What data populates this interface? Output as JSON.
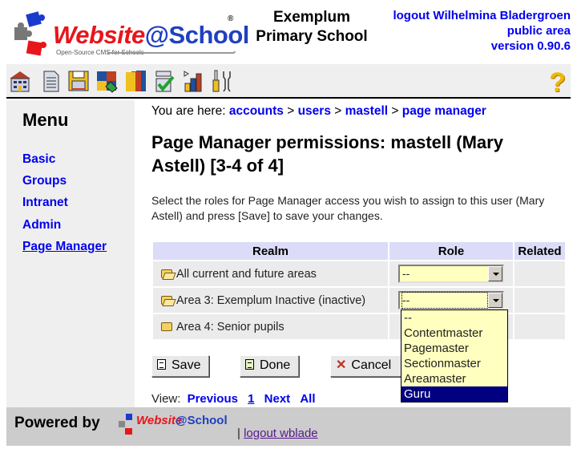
{
  "header": {
    "logo_text_part1": "Website",
    "logo_text_part2": "@School",
    "logo_tagline": "Open-Source CMS for Schools",
    "logo_reg": "®",
    "school_name_line1": "Exemplum",
    "school_name_line2": "Primary School",
    "logout_link": "logout Wilhelmina Bladergroen",
    "area_link": "public area",
    "version": "version 0.90.6"
  },
  "toolbar": {
    "icons": [
      "start-center",
      "page-manager",
      "file-manager",
      "modules",
      "account-manager",
      "configuration-manager",
      "statistics",
      "tools"
    ],
    "help_label": "?"
  },
  "sidebar": {
    "title": "Menu",
    "items": [
      {
        "label": "Basic",
        "active": false
      },
      {
        "label": "Groups",
        "active": false
      },
      {
        "label": "Intranet",
        "active": false
      },
      {
        "label": "Admin",
        "active": false
      },
      {
        "label": "Page Manager",
        "active": true
      }
    ]
  },
  "breadcrumb": {
    "prefix": "You are here:",
    "items": [
      "accounts",
      "users",
      "mastell",
      "page manager"
    ],
    "separator": ">"
  },
  "main": {
    "title": "Page Manager permissions: mastell (Mary Astell) [3-4 of 4]",
    "intro": "Select the roles for Page Manager access you wish to assign to this user (Mary Astell) and press [Save] to save your changes.",
    "table": {
      "headers": [
        "Realm",
        "Role",
        "Related"
      ],
      "rows": [
        {
          "realm": "All current and future areas",
          "role": "--",
          "related": "",
          "folder": "open"
        },
        {
          "realm": "Area 3: Exemplum Inactive (inactive)",
          "role": "--",
          "related": "",
          "folder": "open"
        },
        {
          "realm": "Area 4: Senior pupils",
          "role": "",
          "related": "",
          "folder": "closed"
        }
      ]
    },
    "dropdown_options": [
      "--",
      "Contentmaster",
      "Pagemaster",
      "Sectionmaster",
      "Areamaster",
      "Guru"
    ],
    "dropdown_highlighted": "Guru",
    "buttons": {
      "save": "Save",
      "done": "Done",
      "cancel": "Cancel"
    },
    "pager": {
      "label": "View:",
      "previous": "Previous",
      "current": "1",
      "next": "Next",
      "all": "All"
    }
  },
  "footer": {
    "powered_by": "Powered by",
    "logo_part1": "Website",
    "logo_part2": "@School",
    "separator": "|",
    "logout": "logout wblade"
  },
  "colors": {
    "link": "#0000ee",
    "table_header_bg": "#dcdcf8",
    "select_bg": "#ffffc0",
    "highlight": "#000080",
    "sidebar_bg": "#efefef",
    "footer_bg": "#cccccc"
  }
}
